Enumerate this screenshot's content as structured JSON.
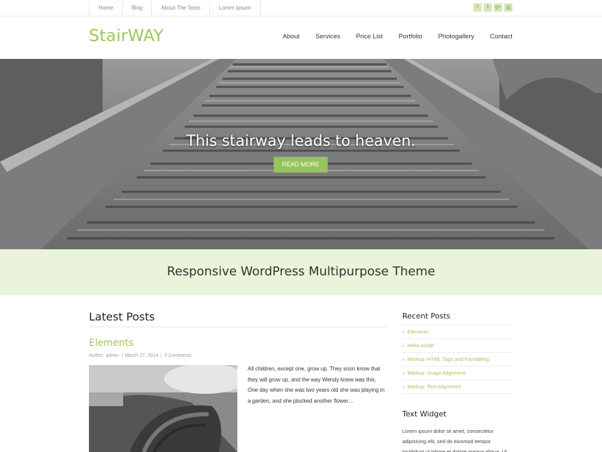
{
  "topbar": {
    "links": [
      "Home",
      "Blog",
      "About The Tests",
      "Lorem Ipsum"
    ],
    "social_icons": [
      "facebook-icon",
      "twitter-icon",
      "googleplus-icon",
      "rss-icon"
    ]
  },
  "header": {
    "logo": "StairWAY",
    "nav": [
      "About",
      "Services",
      "Price List",
      "Portfolio",
      "Photogallery",
      "Contact"
    ]
  },
  "hero": {
    "title": "This stairway leads to heaven.",
    "button": "READ MORE"
  },
  "tagline": "Responsive WordPress Multipurpose Theme",
  "latest_posts": {
    "heading": "Latest Posts",
    "post": {
      "title": "Elements",
      "author": "Author: admin",
      "date": "March 27, 2014",
      "comments": "0 Comments",
      "excerpt": "All children, except one, grow up. They soon know that they will grow up, and the way Wendy knew was this. One day when she was two years old she was playing in a garden, and she plucked another flower…"
    }
  },
  "sidebar": {
    "recent_title": "Recent Posts",
    "recent_posts": [
      "Elements",
      "Hello world!",
      "Markup: HTML Tags and Formatting",
      "Markup: Image Alignment",
      "Markup: Text Alignment"
    ],
    "text_widget_title": "Text Widget",
    "text_widget_body": "Lorem ipsum dolor sit amet, consectetur adipisicing elit, sed do eiusmod tempor incididunt ut labore et dolore magna aliqua. Ut"
  },
  "colors": {
    "accent": "#9cc75a",
    "band_bg": "#eaf4dc"
  }
}
